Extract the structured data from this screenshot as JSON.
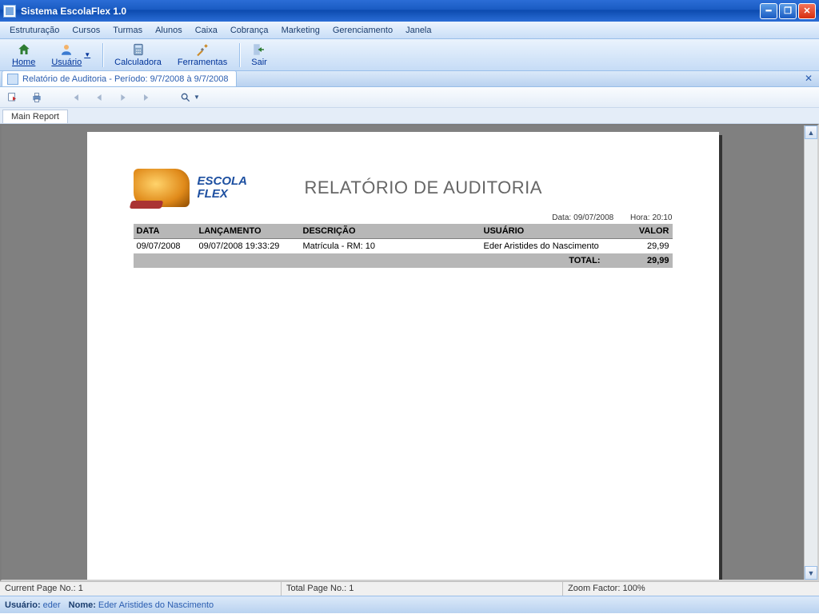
{
  "window": {
    "title": "Sistema EscolaFlex 1.0"
  },
  "menu": {
    "items": [
      "Estruturação",
      "Cursos",
      "Turmas",
      "Alunos",
      "Caixa",
      "Cobrança",
      "Marketing",
      "Gerenciamento",
      "Janela"
    ]
  },
  "toolbar": {
    "home": "Home",
    "usuario": "Usuário",
    "calculadora": "Calculadora",
    "ferramentas": "Ferramentas",
    "sair": "Sair"
  },
  "docTab": {
    "title": "Relatório de Auditoria - Período: 9/7/2008 à 9/7/2008"
  },
  "reportTab": {
    "main": "Main Report"
  },
  "report": {
    "brand1": "ESCOLA",
    "brand2": "FLEX",
    "title": "RELATÓRIO DE AUDITORIA",
    "meta": {
      "dataLabel": "Data:",
      "dataValue": "09/07/2008",
      "horaLabel": "Hora:",
      "horaValue": "20:10"
    },
    "columns": {
      "data": "DATA",
      "lanc": "LANÇAMENTO",
      "desc": "DESCRIÇÃO",
      "user": "USUÁRIO",
      "valor": "VALOR"
    },
    "rows": [
      {
        "data": "09/07/2008",
        "lanc": "09/07/2008 19:33:29",
        "desc": "Matrícula - RM: 10",
        "user": "Eder Aristides do Nascimento",
        "valor": "29,99"
      }
    ],
    "totalLabel": "TOTAL:",
    "totalValue": "29,99"
  },
  "status": {
    "currentPage": "Current Page No.: 1",
    "totalPage": "Total Page No.: 1",
    "zoom": "Zoom Factor: 100%"
  },
  "appStatus": {
    "usuarioLabel": "Usuário:",
    "usuario": "eder",
    "nomeLabel": "Nome:",
    "nome": "Eder Aristides do Nascimento"
  }
}
